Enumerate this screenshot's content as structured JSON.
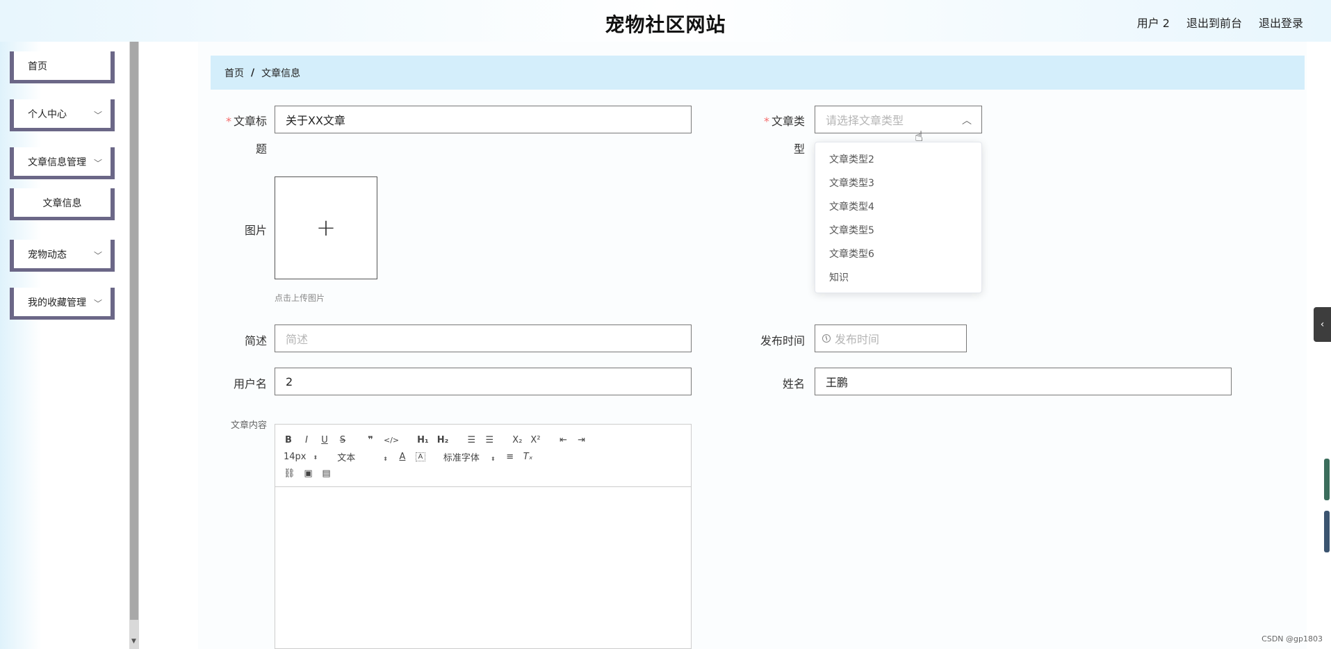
{
  "header": {
    "title": "宠物社区网站",
    "user": "用户 2",
    "to_front": "退出到前台",
    "logout": "退出登录"
  },
  "sidebar": {
    "items": [
      {
        "label": "首页"
      },
      {
        "label": "个人中心"
      },
      {
        "label": "文章信息管理"
      },
      {
        "label": "文章信息"
      },
      {
        "label": "宠物动态"
      },
      {
        "label": "我的收藏管理"
      }
    ]
  },
  "breadcrumb": {
    "home": "首页",
    "separator": "/",
    "current": "文章信息"
  },
  "form": {
    "title_label_1": "文章标",
    "title_label_2": "题",
    "title_value": "关于XX文章",
    "type_label_1": "文章类",
    "type_label_2": "型",
    "type_placeholder": "请选择文章类型",
    "image_label": "图片",
    "upload_plus": "+",
    "upload_hint": "点击上传图片",
    "summary_label": "简述",
    "summary_placeholder": "简述",
    "publish_label": "发布时间",
    "publish_placeholder": "发布时间",
    "username_label": "用户名",
    "username_value": "2",
    "name_label": "姓名",
    "name_value": "王鹏",
    "content_label": "文章内容",
    "required_mark": "*"
  },
  "dropdown": {
    "options": [
      "文章类型2",
      "文章类型3",
      "文章类型4",
      "文章类型5",
      "文章类型6",
      "知识"
    ]
  },
  "editor": {
    "font_size": "14px",
    "header_type": "文本",
    "font_family": "标准字体"
  },
  "watermark": "CSDN @gp1803"
}
